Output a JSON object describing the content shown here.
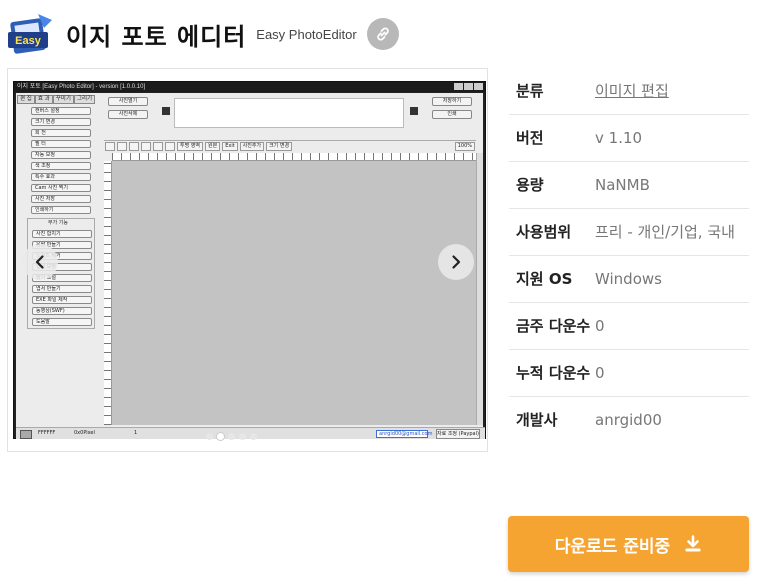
{
  "header": {
    "title": "이지 포토 에디터",
    "subtitle": "Easy PhotoEditor",
    "icon_text": "Easy",
    "link_icon": "link-icon"
  },
  "gallery": {
    "dot_count": 5,
    "active_dot": 1,
    "screenshot": {
      "window_title": "이지 포토 [Easy Photo Editor] - version [1.0.0.10]",
      "side_tabs": [
        "편 집",
        "효 과",
        "꾸미기",
        "그리기"
      ],
      "side_buttons": [
        "캔버스 설정",
        "크기 변경",
        "회 전",
        "필 터",
        "자동 보정",
        "색 조정",
        "특수 효과",
        "Cam 사진 찍기",
        "사진 저장",
        "인쇄하기"
      ],
      "group_label": "부가 기능",
      "group_buttons": [
        "사진 합치기",
        "움짤 만들기",
        "노이즈 제거",
        "얼굴 보정",
        "밝기 조절",
        "엽서 만들기",
        "EXE 파일 제작",
        "동영상(SWF)",
        "도움말"
      ],
      "top_buttons": [
        "사진열기",
        "사진삭제"
      ],
      "top_right_buttons": [
        "저장하기",
        "인쇄"
      ],
      "toolbar": [
        "투명 영역",
        "원본",
        "Exit",
        "사진추가",
        "크기 변경"
      ],
      "zoom": "100%",
      "status_color": "FFFFFF",
      "status_pos": "0x0Pixel",
      "status_count": "1",
      "status_email": "anrgid00@gmail.com",
      "status_button": "자료 조정 (Paypal)"
    }
  },
  "info": {
    "rows": [
      {
        "key": "분류",
        "value": "이미지 편집",
        "link": true
      },
      {
        "key": "버전",
        "value": "v 1.10"
      },
      {
        "key": "용량",
        "value": "NaNMB"
      },
      {
        "key": "사용범위",
        "value": "프리 - 개인/기업, 국내"
      },
      {
        "key": "지원 OS",
        "value": "Windows"
      },
      {
        "key": "금주 다운수",
        "value": "0"
      },
      {
        "key": "누적 다운수",
        "value": "0"
      },
      {
        "key": "개발사",
        "value": "anrgid00"
      }
    ]
  },
  "download": {
    "label": "다운로드 준비중",
    "icon": "download-icon"
  },
  "colors": {
    "accent": "#f5a331",
    "link_button": "#b8b8b8",
    "icon_blue": "#2f5fb5"
  }
}
